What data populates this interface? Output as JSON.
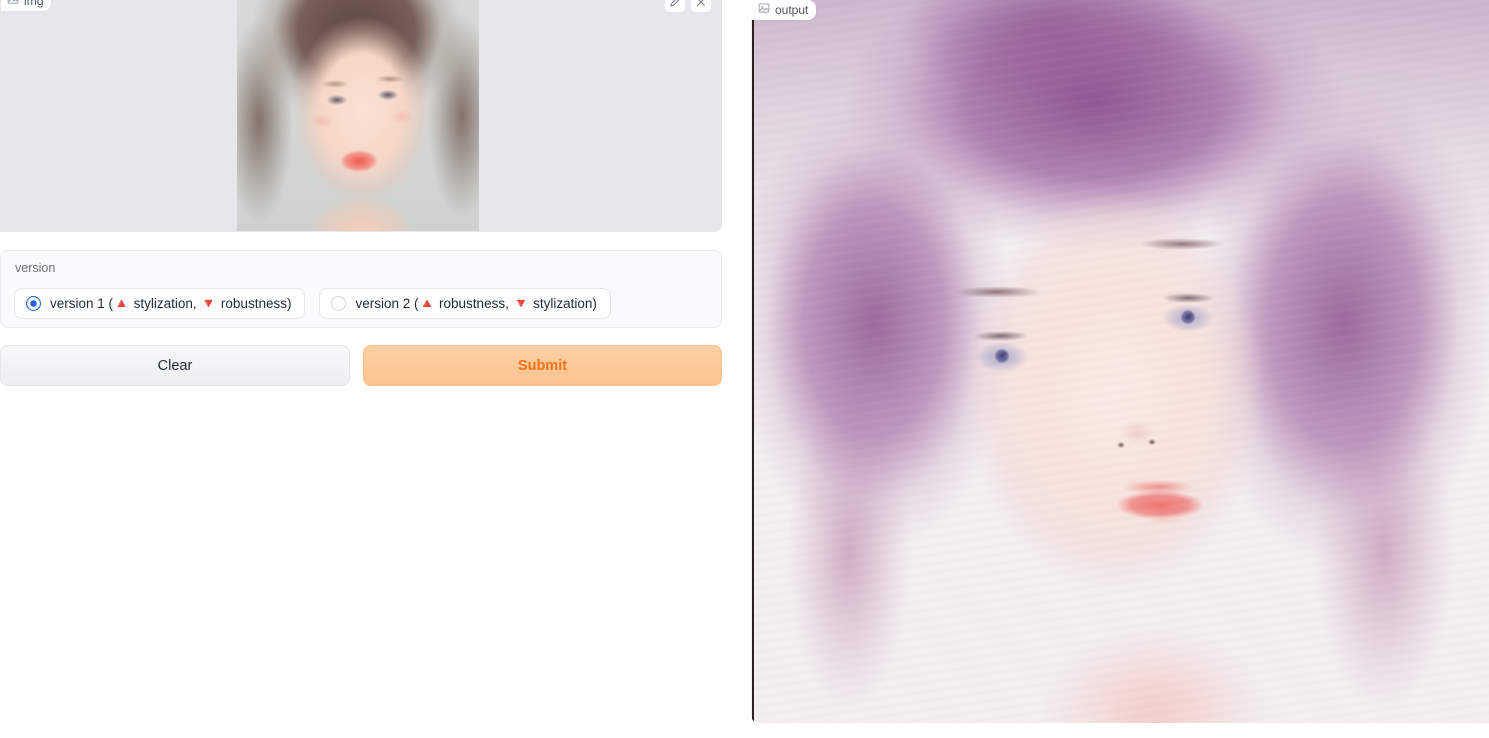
{
  "input_panel": {
    "label": "img",
    "label_icon": "image-icon",
    "tools": [
      {
        "name": "edit-icon",
        "title": "Edit"
      },
      {
        "name": "close-icon",
        "title": "Clear image"
      }
    ],
    "image_description": "Photograph of a young woman with dark brown hair tied back, fair skin, facing the camera on a light gray background"
  },
  "version_group": {
    "title": "version",
    "options": [
      {
        "id": "version-1",
        "prefix": "version 1 (",
        "up_icon": "🔺",
        "mid": " stylization, ",
        "down_icon": "🔻",
        "suffix": " robustness)",
        "full_label": "version 1 (🔺 stylization, 🔻 robustness)",
        "selected": true
      },
      {
        "id": "version-2",
        "prefix": "version 2 (",
        "up_icon": "🔺",
        "mid": " robustness, ",
        "down_icon": "🔻",
        "suffix": " stylization)",
        "full_label": "version 2 (🔺 robustness, 🔻 stylization)",
        "selected": false
      }
    ]
  },
  "actions": {
    "clear_label": "Clear",
    "submit_label": "Submit"
  },
  "output_panel": {
    "label": "output",
    "label_icon": "image-icon",
    "image_description": "Stylized anime-style painted portrait of a young woman with purple and magenta hair, large blue eyes and pink lips on a pale pink background"
  },
  "colors": {
    "radio_selected": "#2563eb",
    "submit_text": "#f97316",
    "submit_background": "#fdd0a4",
    "panel_background": "#f9fafb",
    "image_area_background": "#e5e7eb",
    "border": "#e5e7eb"
  }
}
